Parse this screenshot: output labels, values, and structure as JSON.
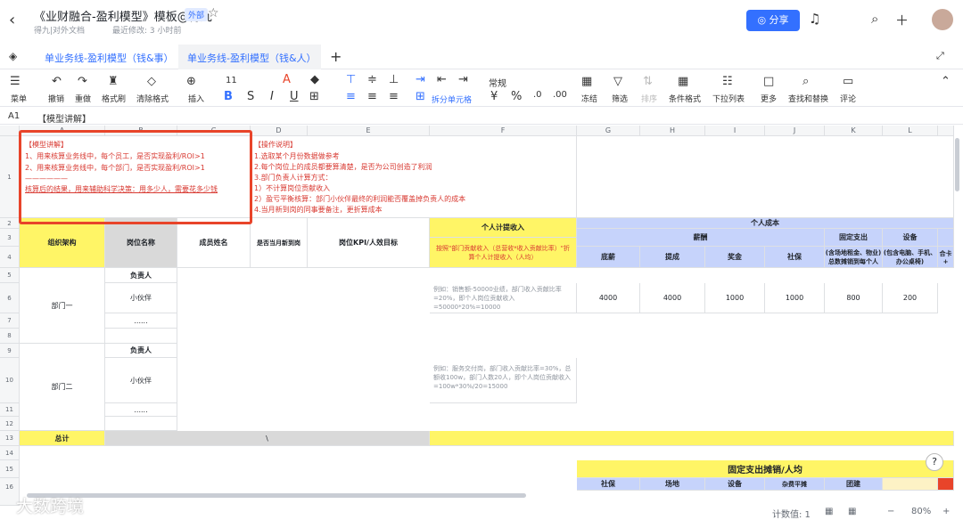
{
  "header": {
    "title": "《业财融合-盈利模型》模板@得九",
    "badge": "外部",
    "location": "得九|对外文档",
    "modified": "最近修改: 3 小时前",
    "share_label": "分享"
  },
  "tabs": [
    "单业务线-盈利模型（钱&事）",
    "单业务线-盈利模型（钱&人）"
  ],
  "toolbar": {
    "menu": "菜单",
    "undo": "撤销",
    "redo": "重做",
    "format_painter": "格式刷",
    "clear_format": "清除格式",
    "insert": "插入",
    "font_size": "11",
    "number_format": "常规",
    "merge": "拆分单元格",
    "freeze": "冻结",
    "filter": "筛选",
    "sort": "排序",
    "conditional": "条件格式",
    "dropdown": "下拉列表",
    "more": "更多",
    "find": "查找和替换",
    "comment": "评论"
  },
  "formula_bar": {
    "cell_ref": "A1",
    "content": "【模型讲解】"
  },
  "columns": [
    "A",
    "B",
    "C",
    "D",
    "E",
    "F",
    "G",
    "H",
    "I",
    "J",
    "K",
    "L"
  ],
  "rows": [
    "1",
    "2",
    "3",
    "4",
    "5",
    "6",
    "7",
    "8",
    "9",
    "10",
    "11",
    "12",
    "13",
    "14",
    "15",
    "16"
  ],
  "model_notes": {
    "title": "【模型讲解】",
    "line1": "1、用来核算业务线中，每个员工，是否实现盈利/ROI>1",
    "line2": "2、用来核算业务线中，每个部门，是否实现盈利/ROI>1",
    "divider": "——————",
    "line3": "核算后的结果，用来辅助科学决策：用多少人，需要花多少钱"
  },
  "ops_notes": {
    "title": "【操作说明】",
    "line1": "1.选取某个月份数据做参考",
    "line2": "2.每个岗位上的成员都要算清楚，是否为公司创造了利润",
    "line3": "3.部门负责人计算方式：",
    "line4": "1）不计算岗位贡献收入",
    "line5": "2）盈亏平衡核算：部门小伙伴最终的利润能否覆盖掉负责人的成本",
    "line6": "4.当月新到岗的同事要备注，更折算成本"
  },
  "table": {
    "org": "组织架构",
    "position": "岗位名称",
    "member": "成员姓名",
    "new_hire": "是否当月新到岗",
    "kpi": "岗位KPI/人效目标",
    "commission": "个人计提收入",
    "commission_note": "按照\"部门贡献收入（总营收*收入贡献比率）\"折算个人计提收入（人均）",
    "personal_cost": "个人成本",
    "salary": "薪酬",
    "fixed": "固定支出",
    "equipment": "设备",
    "base": "底薪",
    "bonus_commission": "提成",
    "bonus": "奖金",
    "social": "社保",
    "rent": "(含场地租金、物业)总数摊销到每个人",
    "device": "(包含电脑、手机、办公桌椅)",
    "extra": "合卡+",
    "dept1": "部门一",
    "dept2": "部门二",
    "leader": "负责人",
    "partner": "小伙伴",
    "ellipsis": "......",
    "total": "总计",
    "backslash": "\\",
    "example1": "例如：销售额-50000业绩，部门收入贡献比率=20%，即个人岗位贡献收入=50000*20%=10000",
    "example2": "例如：服务交付岗，部门收入贡献比率=30%，总额收100w，部门人数20人，即个人岗位贡献收入=100w*30%/20=15000",
    "values": [
      "4000",
      "4000",
      "1000",
      "1000",
      "800",
      "200"
    ],
    "fixed_title": "固定支出摊销/人均",
    "fixed_cols": [
      "社保",
      "场地",
      "设备",
      "杂费平摊",
      "团建"
    ]
  },
  "status": {
    "count": "计数值: 1",
    "zoom": "80%"
  },
  "watermark": "大数跨境"
}
